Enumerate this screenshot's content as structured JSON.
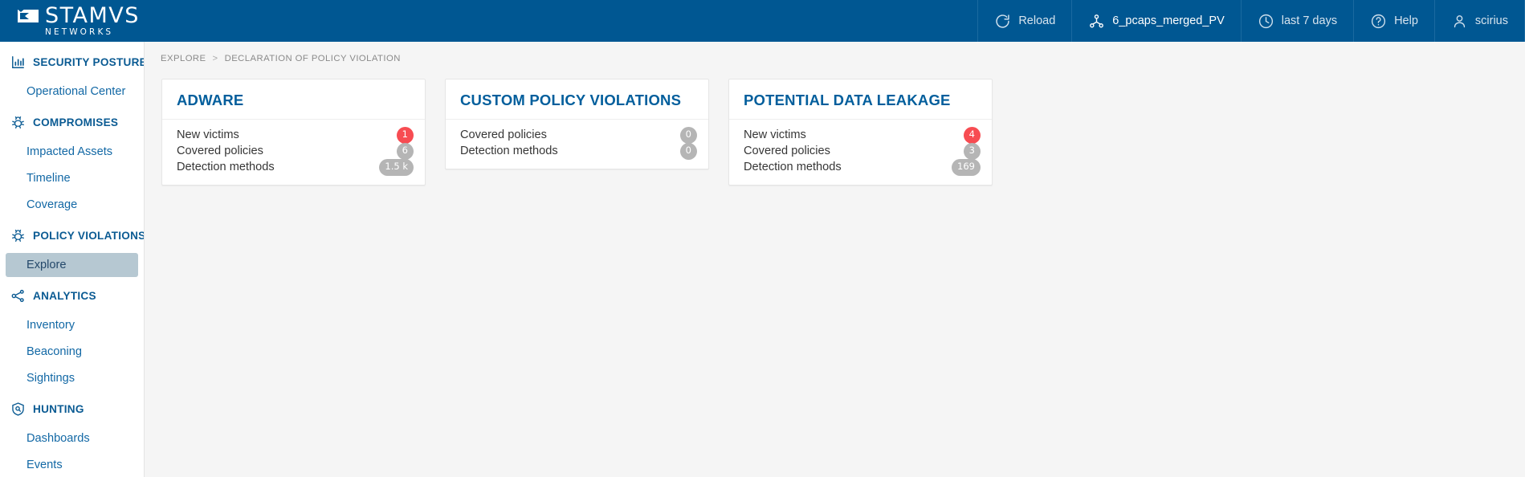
{
  "brand": {
    "name": "STAMVS",
    "subtitle": "NETWORKS",
    "logo_icon": "stamus-arrow-logo"
  },
  "topbar": {
    "background_color": "#005792",
    "items": [
      {
        "label": "Reload",
        "icon": "reload-icon",
        "name": "reload-button"
      },
      {
        "label": "6_pcaps_merged_PV",
        "icon": "network-nodes-icon",
        "name": "tenant-selector"
      },
      {
        "label": "last 7 days",
        "icon": "clock-icon",
        "name": "time-range-selector"
      },
      {
        "label": "Help",
        "icon": "help-circle-icon",
        "name": "help-button"
      },
      {
        "label": "scirius",
        "icon": "user-icon",
        "name": "user-menu"
      }
    ]
  },
  "sidebar": {
    "active_item": "Explore",
    "active_bg": "#b6c8d2",
    "link_color": "#1268a5",
    "groups": [
      {
        "label": "SECURITY POSTURE",
        "icon": "bar-chart-icon",
        "items": [
          {
            "label": "Operational Center"
          }
        ]
      },
      {
        "label": "COMPROMISES",
        "icon": "bug-icon",
        "items": [
          {
            "label": "Impacted Assets"
          },
          {
            "label": "Timeline"
          },
          {
            "label": "Coverage"
          }
        ]
      },
      {
        "label": "POLICY VIOLATIONS",
        "icon": "bug-icon",
        "items": [
          {
            "label": "Explore"
          }
        ]
      },
      {
        "label": "ANALYTICS",
        "icon": "share-nodes-icon",
        "items": [
          {
            "label": "Inventory"
          },
          {
            "label": "Beaconing"
          },
          {
            "label": "Sightings"
          }
        ]
      },
      {
        "label": "HUNTING",
        "icon": "shield-search-icon",
        "items": [
          {
            "label": "Dashboards"
          },
          {
            "label": "Events"
          }
        ]
      }
    ]
  },
  "breadcrumb": {
    "parent": "EXPLORE",
    "separator": ">",
    "current": "DECLARATION OF POLICY VIOLATION"
  },
  "cards": [
    {
      "title": "ADWARE",
      "rows": [
        {
          "label": "New victims",
          "value": "1",
          "badge_style": "red"
        },
        {
          "label": "Covered policies",
          "value": "6",
          "badge_style": "gray"
        },
        {
          "label": "Detection methods",
          "value": "1.5 k",
          "badge_style": "gray"
        }
      ]
    },
    {
      "title": "CUSTOM POLICY VIOLATIONS",
      "rows": [
        {
          "label": "Covered policies",
          "value": "0",
          "badge_style": "gray"
        },
        {
          "label": "Detection methods",
          "value": "0",
          "badge_style": "gray"
        }
      ]
    },
    {
      "title": "POTENTIAL DATA LEAKAGE",
      "rows": [
        {
          "label": "New victims",
          "value": "4",
          "badge_style": "red"
        },
        {
          "label": "Covered policies",
          "value": "3",
          "badge_style": "gray"
        },
        {
          "label": "Detection methods",
          "value": "169",
          "badge_style": "gray"
        }
      ]
    }
  ],
  "colors": {
    "brand_blue": "#005792",
    "title_blue": "#015e9c",
    "badge_red": "#f74c52",
    "badge_gray": "#b5b5b5",
    "page_bg": "#f5f5f5"
  }
}
